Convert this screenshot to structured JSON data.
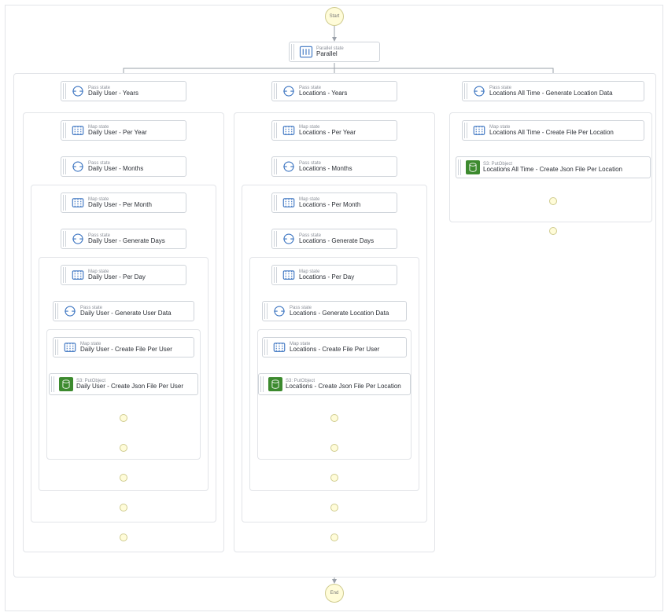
{
  "start_label": "Start",
  "end_label": "End",
  "root": {
    "type": "Parallel state",
    "title": "Parallel"
  },
  "branches": [
    [
      {
        "type": "Pass state",
        "title": "Daily User - Years",
        "icon": "pass"
      },
      {
        "type": "Map state",
        "title": "Daily User - Per Year",
        "icon": "map"
      },
      {
        "type": "Pass state",
        "title": "Daily User - Months",
        "icon": "pass"
      },
      {
        "type": "Map state",
        "title": "Daily User - Per Month",
        "icon": "map"
      },
      {
        "type": "Pass state",
        "title": "Daily User - Generate Days",
        "icon": "pass"
      },
      {
        "type": "Map state",
        "title": "Daily User - Per Day",
        "icon": "map"
      },
      {
        "type": "Pass state",
        "title": "Daily User - Generate User Data",
        "icon": "pass"
      },
      {
        "type": "Map state",
        "title": "Daily User - Create File Per User",
        "icon": "map"
      },
      {
        "type": "S3: PutObject",
        "title": "Daily User - Create Json File Per User",
        "icon": "s3"
      }
    ],
    [
      {
        "type": "Pass state",
        "title": "Locations - Years",
        "icon": "pass"
      },
      {
        "type": "Map state",
        "title": "Locations - Per Year",
        "icon": "map"
      },
      {
        "type": "Pass state",
        "title": "Locations - Months",
        "icon": "pass"
      },
      {
        "type": "Map state",
        "title": "Locations - Per Month",
        "icon": "map"
      },
      {
        "type": "Pass state",
        "title": "Locations - Generate Days",
        "icon": "pass"
      },
      {
        "type": "Map state",
        "title": "Locations - Per Day",
        "icon": "map"
      },
      {
        "type": "Pass state",
        "title": "Locations - Generate Location Data",
        "icon": "pass"
      },
      {
        "type": "Map state",
        "title": "Locations - Create File Per User",
        "icon": "map"
      },
      {
        "type": "S3: PutObject",
        "title": "Locations - Create Json File Per Location",
        "icon": "s3"
      }
    ],
    [
      {
        "type": "Pass state",
        "title": "Locations All Time - Generate Location Data",
        "icon": "pass"
      },
      {
        "type": "Map state",
        "title": "Locations All Time - Create File Per Location",
        "icon": "map"
      },
      {
        "type": "S3: PutObject",
        "title": "Locations All Time - Create Json File Per Location",
        "icon": "s3"
      }
    ]
  ]
}
